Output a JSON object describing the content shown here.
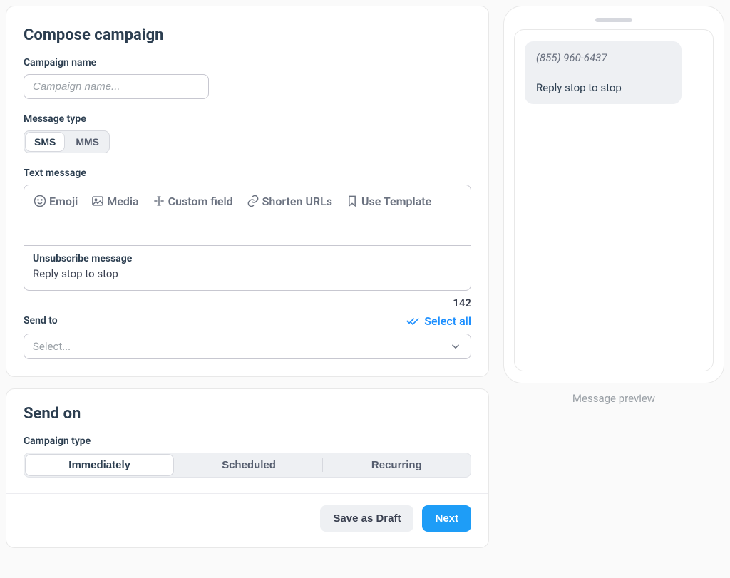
{
  "compose": {
    "title": "Compose campaign",
    "campaign_name_label": "Campaign name",
    "campaign_name_placeholder": "Campaign name...",
    "message_type_label": "Message type",
    "message_type_options": {
      "sms": "SMS",
      "mms": "MMS"
    },
    "text_message_label": "Text message",
    "toolbar": {
      "emoji": "Emoji",
      "media": "Media",
      "custom_field": "Custom field",
      "shorten_urls": "Shorten URLs",
      "use_template": "Use Template"
    },
    "unsubscribe_label": "Unsubscribe message",
    "unsubscribe_text": "Reply stop to stop",
    "char_count": "142",
    "send_to_label": "Send to",
    "select_all": "Select all",
    "select_placeholder": "Select..."
  },
  "send_on": {
    "title": "Send on",
    "campaign_type_label": "Campaign type",
    "options": {
      "immediately": "Immediately",
      "scheduled": "Scheduled",
      "recurring": "Recurring"
    },
    "save_draft": "Save as Draft",
    "next": "Next"
  },
  "preview": {
    "from_number": "(855) 960-6437",
    "body": "Reply stop to stop",
    "label": "Message preview"
  }
}
